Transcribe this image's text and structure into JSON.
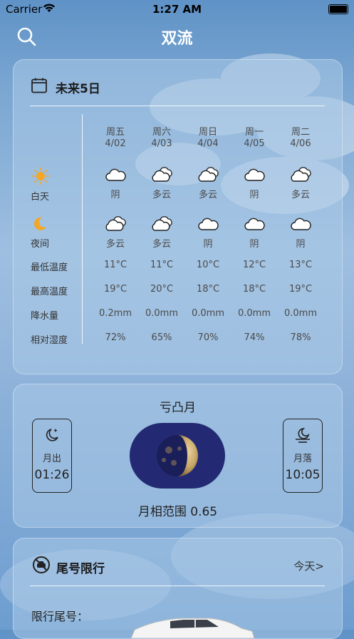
{
  "status_bar": {
    "carrier": "Carrier",
    "time": "1:27 AM"
  },
  "header": {
    "city": "双流"
  },
  "forecast": {
    "title": "未来5日",
    "row_labels": {
      "day": "白天",
      "night": "夜间",
      "min_temp": "最低温度",
      "max_temp": "最高温度",
      "precip": "降水量",
      "humidity": "相对湿度"
    },
    "days": [
      {
        "dow": "周五",
        "date": "4/02",
        "day_icon": "cloud-icon",
        "day_desc": "阴",
        "night_icon": "partly-cloudy-icon",
        "night_desc": "多云",
        "min": "11°C",
        "max": "19°C",
        "precip": "0.2mm",
        "humidity": "72%"
      },
      {
        "dow": "周六",
        "date": "4/03",
        "day_icon": "partly-cloudy-icon",
        "day_desc": "多云",
        "night_icon": "partly-cloudy-icon",
        "night_desc": "多云",
        "min": "11°C",
        "max": "20°C",
        "precip": "0.0mm",
        "humidity": "65%"
      },
      {
        "dow": "周日",
        "date": "4/04",
        "day_icon": "partly-cloudy-icon",
        "day_desc": "多云",
        "night_icon": "cloud-icon",
        "night_desc": "阴",
        "min": "10°C",
        "max": "18°C",
        "precip": "0.0mm",
        "humidity": "70%"
      },
      {
        "dow": "周一",
        "date": "4/05",
        "day_icon": "cloud-icon",
        "day_desc": "阴",
        "night_icon": "cloud-icon",
        "night_desc": "阴",
        "min": "12°C",
        "max": "18°C",
        "precip": "0.0mm",
        "humidity": "74%"
      },
      {
        "dow": "周二",
        "date": "4/06",
        "day_icon": "partly-cloudy-icon",
        "day_desc": "多云",
        "night_icon": "cloud-icon",
        "night_desc": "阴",
        "min": "13°C",
        "max": "19°C",
        "precip": "0.0mm",
        "humidity": "78%"
      }
    ]
  },
  "moon": {
    "title": "亏凸月",
    "moonrise_label": "月出",
    "moonrise_time": "01:26",
    "moonset_label": "月落",
    "moonset_time": "10:05",
    "phase_text": "月相范围 0.65"
  },
  "traffic": {
    "title": "尾号限行",
    "today_link": "今天>",
    "plate_label": "限行尾号："
  },
  "colors": {
    "moon_pill": "#232a73",
    "sun": "#f5a623"
  }
}
